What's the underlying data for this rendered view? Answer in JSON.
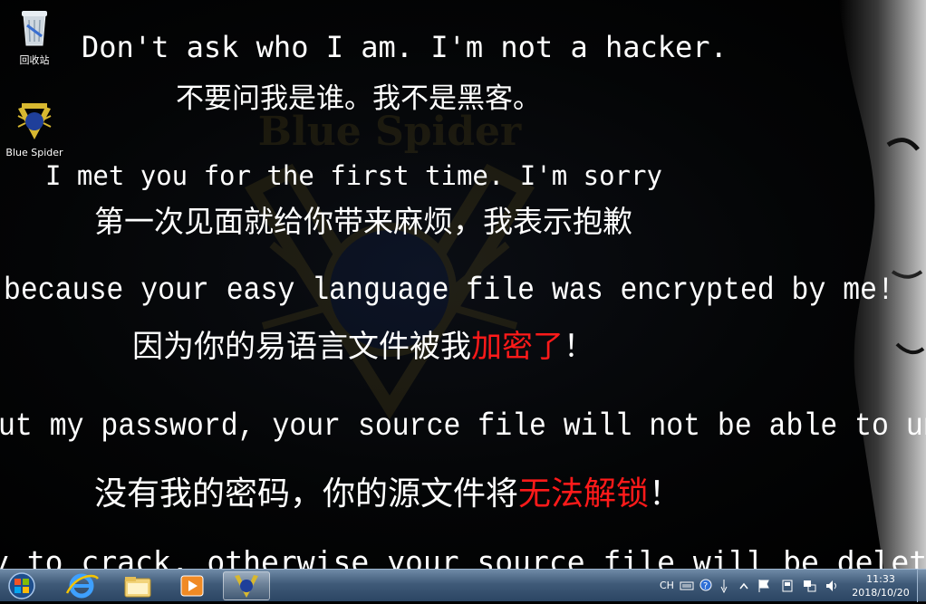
{
  "desktop": {
    "icons": [
      {
        "label": "回收站"
      },
      {
        "label": "Blue Spider"
      }
    ],
    "watermark": "Blue Spider",
    "message_lines": [
      {
        "parts": [
          {
            "text": "Don't ask who I am. I'm not a hacker.",
            "red": false
          }
        ]
      },
      {
        "parts": [
          {
            "text": "不要问我是谁。我不是黑客。",
            "red": false
          }
        ]
      },
      {
        "parts": [
          {
            "text": "I met you for the first time. I'm sorry",
            "red": false
          }
        ]
      },
      {
        "parts": [
          {
            "text": "第一次见面就给你带来麻烦，我表示抱歉",
            "red": false
          }
        ]
      },
      {
        "parts": [
          {
            "text": "because your easy language file was encrypted by me!",
            "red": false
          }
        ]
      },
      {
        "parts": [
          {
            "text": "因为你的易语言文件被我",
            "red": false
          },
          {
            "text": "加密了",
            "red": true
          },
          {
            "text": "！",
            "red": false
          }
        ]
      },
      {
        "parts": [
          {
            "text": "ut my password, your source file will not be able to unlock!",
            "red": false
          }
        ]
      },
      {
        "parts": [
          {
            "text": "没有我的密码，你的源文件将",
            "red": false
          },
          {
            "text": "无法解锁",
            "red": true
          },
          {
            "text": "！",
            "red": false
          }
        ]
      },
      {
        "parts": [
          {
            "text": "y to crack, otherwise your source file will be deleted",
            "red": false
          }
        ]
      }
    ]
  },
  "taskbar": {
    "pinned": [
      "start-orb-icon",
      "internet-explorer-icon",
      "file-explorer-icon",
      "media-player-icon",
      "blue-spider-app-icon"
    ],
    "tray": {
      "language": "CH",
      "time": "11:33",
      "date": "2018/10/20"
    }
  },
  "colors": {
    "alert_red": "#ff1a1a",
    "taskbar_blue": "#3f5a78"
  }
}
